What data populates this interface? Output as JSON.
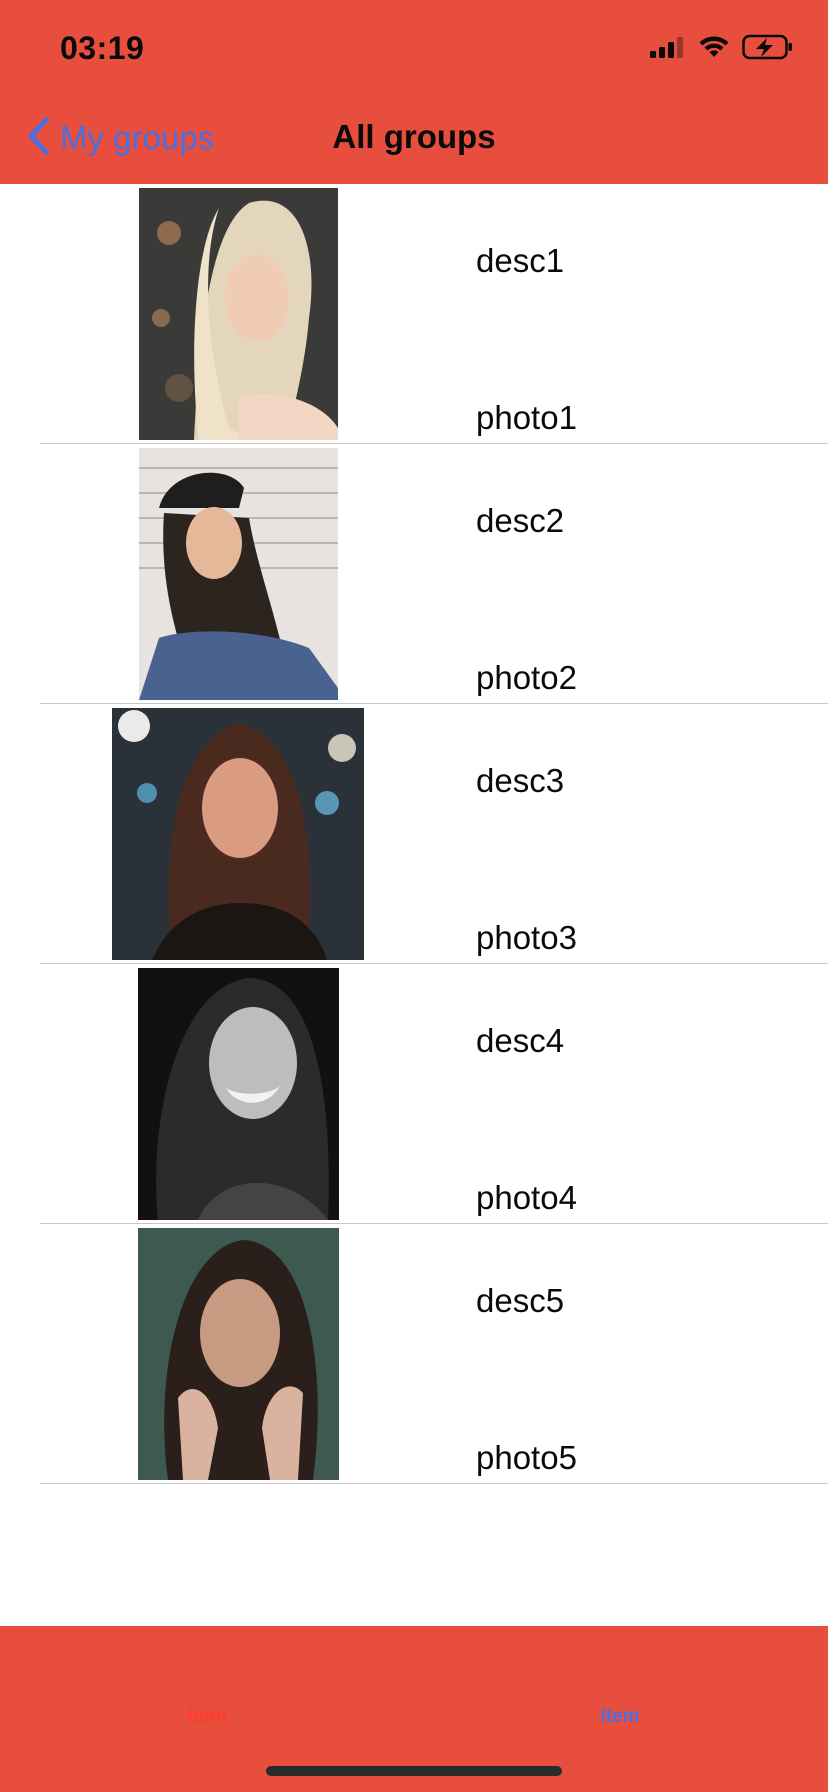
{
  "status": {
    "time": "03:19"
  },
  "nav": {
    "back_label": "My groups",
    "title": "All groups"
  },
  "rows": [
    {
      "desc": "desc1",
      "title": "photo1"
    },
    {
      "desc": "desc2",
      "title": "photo2"
    },
    {
      "desc": "desc3",
      "title": "photo3"
    },
    {
      "desc": "desc4",
      "title": "photo4"
    },
    {
      "desc": "desc5",
      "title": "photo5"
    }
  ],
  "tabs": [
    {
      "label": "Item",
      "color": "#ff3b30"
    },
    {
      "label": "Item",
      "color": "#4A6FE3"
    }
  ],
  "colors": {
    "bar": "#E84E3E",
    "accent": "#4A6FE3"
  }
}
